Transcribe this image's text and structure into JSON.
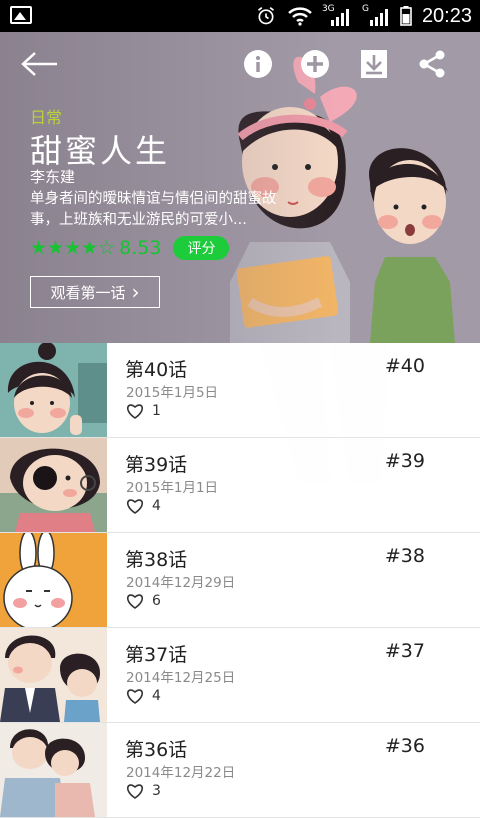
{
  "status_bar": {
    "time": "20:23",
    "network_3g": "3G",
    "network_g": "G"
  },
  "toolbar": {
    "back_icon": "back-arrow-icon",
    "info_icon": "info-icon",
    "add_icon": "add-icon",
    "download_icon": "download-icon",
    "share_icon": "share-icon"
  },
  "comic": {
    "category": "日常",
    "title": "甜蜜人生",
    "author": "李东建",
    "description": "单身者间的暧昧情谊与情侣间的甜蜜故事，上班族和无业游民的可爱小...",
    "stars": "★★★★☆",
    "score": "8.53",
    "rate_label": "评分",
    "watch_label": "观看第一话",
    "watch_chevron": "›"
  },
  "colors": {
    "accent_green": "#1ccc3a",
    "category_color": "#b8d23a",
    "hero_bg": "#a29aa6"
  },
  "episodes": [
    {
      "title": "第40话",
      "date": "2015年1月5日",
      "likes": "1",
      "number": "#40"
    },
    {
      "title": "第39话",
      "date": "2015年1月1日",
      "likes": "4",
      "number": "#39"
    },
    {
      "title": "第38话",
      "date": "2014年12月29日",
      "likes": "6",
      "number": "#38"
    },
    {
      "title": "第37话",
      "date": "2014年12月25日",
      "likes": "4",
      "number": "#37"
    },
    {
      "title": "第36话",
      "date": "2014年12月22日",
      "likes": "3",
      "number": "#36"
    }
  ]
}
